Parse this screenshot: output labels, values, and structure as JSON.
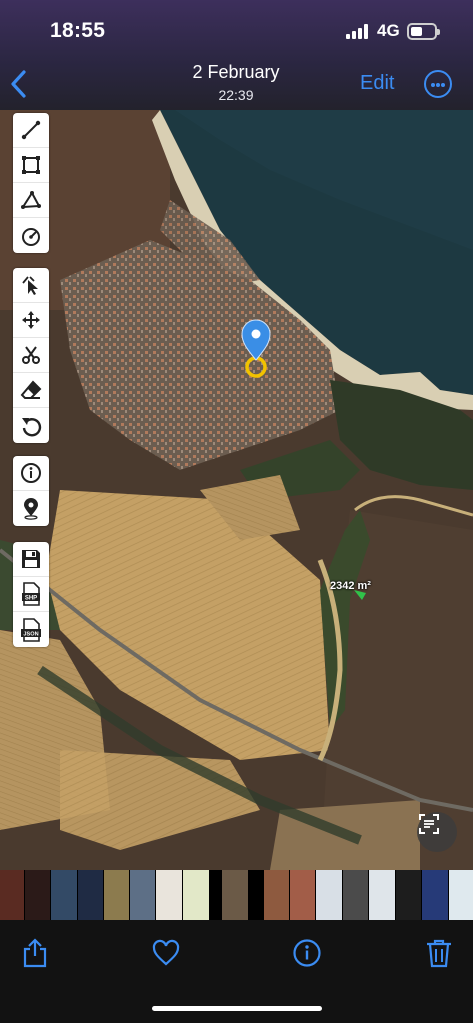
{
  "status_bar": {
    "time": "18:55",
    "network": "4G",
    "battery_level": 0.3
  },
  "nav": {
    "back_icon": "chevron-left-icon",
    "title": "2 February",
    "subtitle": "22:39",
    "edit_label": "Edit",
    "more_icon": "ellipsis-circle-icon"
  },
  "map": {
    "area_label": "2342 m²",
    "toolbar_group_1": [
      "line-tool-icon",
      "polygon-tool-icon",
      "path-tool-icon",
      "circle-tool-icon"
    ],
    "toolbar_group_2": [
      "select-pointer-icon",
      "move-icon",
      "scissors-icon",
      "eraser-icon",
      "undo-icon"
    ],
    "toolbar_group_3": [
      "info-icon",
      "location-pin-icon"
    ],
    "toolbar_group_4": [
      "save-icon",
      "shp-export-icon",
      "json-export-icon"
    ],
    "shp_label": "SHP",
    "json_label": "JSON",
    "scan_icon": "live-text-icon"
  },
  "bottom_toolbar": [
    "share-icon",
    "heart-icon",
    "info-icon",
    "trash-icon"
  ],
  "colors": {
    "accent": "#3b8cf2",
    "pin": "#3a8ee6",
    "ring": "#f2c200"
  }
}
